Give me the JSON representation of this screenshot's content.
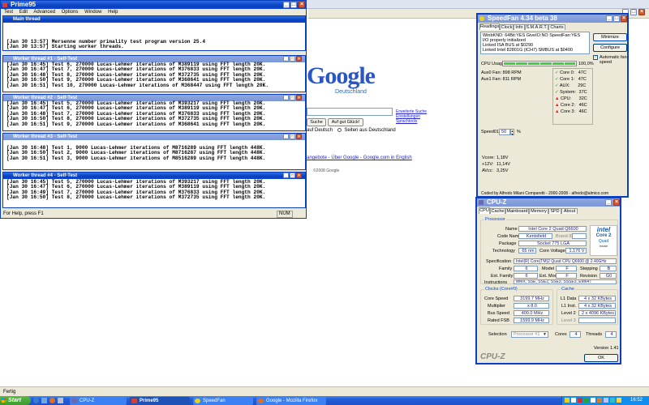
{
  "prime95": {
    "title": "Prime95",
    "menu": [
      "Test",
      "Edit",
      "Advanced",
      "Options",
      "Window",
      "Help"
    ],
    "status_text": "For Help, press F1",
    "status_num": "NUM",
    "main_thread": {
      "title": "Main thread",
      "lines": [
        "[Jan 30 13:57] Mersenne number primality test program version 25.4",
        "[Jan 30 13:57] Starting worker threads."
      ]
    },
    "workers": [
      {
        "title": "Worker thread #1 - Self-Test",
        "lines": [
          "[Jan 30 16:45] Test 6, 270000 Lucas-Lehmer iterations of M389119 using FFT length 20K.",
          "[Jan 30 16:47] Test 7, 270000 Lucas-Lehmer iterations of M376833 using FFT length 20K.",
          "[Jan 30 16:48] Test 8, 270000 Lucas-Lehmer iterations of M372735 using FFT length 20K.",
          "[Jan 30 16:50] Test 9, 270000 Lucas-Lehmer iterations of M368641 using FFT length 20K.",
          "[Jan 30 16:51] Test 10, 270000 Lucas-Lehmer iterations of M368447 using FFT length 20K."
        ]
      },
      {
        "title": "Worker thread #2 - Self-Test",
        "lines": [
          "[Jan 30 16:45] Test 5, 270000 Lucas-Lehmer iterations of M393217 using FFT length 20K.",
          "[Jan 30 16:47] Test 6, 270000 Lucas-Lehmer iterations of M389119 using FFT length 20K.",
          "[Jan 30 16:48] Test 7, 270000 Lucas-Lehmer iterations of M376833 using FFT length 20K.",
          "[Jan 30 16:50] Test 8, 270000 Lucas-Lehmer iterations of M372735 using FFT length 20K.",
          "[Jan 30 16:51] Test 9, 270000 Lucas-Lehmer iterations of M368641 using FFT length 20K."
        ]
      },
      {
        "title": "Worker thread #3 - Self-Test",
        "lines": [
          "[Jan 30 16:48] Test 1, 9000 Lucas-Lehmer iterations of M8716289 using FFT length 448K.",
          "[Jan 30 16:50] Test 2, 9000 Lucas-Lehmer iterations of M8716287 using FFT length 448K.",
          "[Jan 30 16:51] Test 3, 9000 Lucas-Lehmer iterations of M8516289 using FFT length 448K."
        ]
      },
      {
        "title": "Worker thread #4 - Self-Test",
        "lines": [
          "[Jan 30 16:45] Test 5, 270000 Lucas-Lehmer iterations of M393217 using FFT length 20K.",
          "[Jan 30 16:47] Test 6, 270000 Lucas-Lehmer iterations of M389119 using FFT length 20K.",
          "[Jan 30 16:49] Test 7, 270000 Lucas-Lehmer iterations of M376833 using FFT length 20K.",
          "[Jan 30 16:50] Test 8, 270000 Lucas-Lehmer iterations of M372735 using FFT length 20K."
        ]
      }
    ]
  },
  "firefox": {
    "logo_text": "Google",
    "logo_sub": "Deutschland",
    "search_btn_partial": "Suche",
    "lucky_btn": "Auf gut Glück!",
    "radio_label_1": "auf Deutsch",
    "radio_label_2": "Seiten aus Deutschland",
    "side_links": [
      "Erweiterte Suche",
      "Einstellungen",
      "Sprachtools"
    ],
    "footer_links": "angebote - Über Google - Google.com in English",
    "copyright": "©2008 Google",
    "status": "Fertig"
  },
  "speedfan": {
    "title": "SpeedFan 4.34 beta 38",
    "tabs": [
      "Readings",
      "Clock",
      "Info",
      "S.M.A.R.T.",
      "Charts"
    ],
    "log_lines": [
      "WinbKND: 64Bit:YES  GiveIO:NO  SpeedFan:YES",
      "I/O properly initialized",
      "Linked ISA BUS at $0290",
      "Linked Intel 82801G (ICH7) SMBUS at $0400"
    ],
    "minimize_btn": "Minimize",
    "configure_btn": "Configure",
    "auto_fan_label": "Automatic fan speed",
    "cpu_usage_label": "CPU Usage",
    "cpu_usage_value": "100,0%",
    "cpu_usage_level": 1.0,
    "fans": [
      "Aux0 Fan: 898 RPM",
      "Aux1 Fan: 811 RPM"
    ],
    "temps": [
      {
        "name": "Core 0:",
        "value": "47C",
        "icon": "check-icon"
      },
      {
        "name": "Core 1:",
        "value": "47C",
        "icon": "check-icon"
      },
      {
        "name": "AUX:",
        "value": "29C",
        "icon": "check-icon"
      },
      {
        "name": "System:",
        "value": "37C",
        "icon": "check-icon"
      },
      {
        "name": "CPU:",
        "value": "32C",
        "icon": "flame-icon"
      },
      {
        "name": "Core 2:",
        "value": "46C",
        "icon": "flame-icon"
      },
      {
        "name": "Core 3:",
        "value": "46C",
        "icon": "flame-icon"
      }
    ],
    "speed_label": "Speed01:",
    "speed_value": "50",
    "speed_unit": "%",
    "voltages": [
      {
        "name": "Vcore:",
        "value": "1,18V"
      },
      {
        "name": "+12V:",
        "value": "11,14V"
      },
      {
        "name": "AVcc:",
        "value": "3,25V"
      }
    ],
    "footer": "Coded by Alfredo Milani Comparetti - 2000-2008 - alfredo@almico.com"
  },
  "cpuz": {
    "title": "CPU-Z",
    "tabs": [
      "CPU",
      "Cache",
      "Mainboard",
      "Memory",
      "SPD",
      "About"
    ],
    "processor_group": "Processor",
    "name_label": "Name",
    "name_value": "Intel Core 2 Quad Q6600",
    "codename_label": "Code Name",
    "codename_value": "Kentsfield",
    "brand_id_label": "Brand ID",
    "package_label": "Package",
    "package_value": "Socket 775 LGA",
    "technology_label": "Technology",
    "technology_value": "65 nm",
    "core_voltage_label": "Core Voltage",
    "core_voltage_value": "1.176 V",
    "spec_label": "Specification",
    "spec_value": "Intel(R) Core(TM)2 Quad CPU     Q6600  @ 2.40GHz",
    "family_label": "Family",
    "family_value": "6",
    "model_label": "Model",
    "model_value": "F",
    "stepping_label": "Stepping",
    "stepping_value": "B",
    "ext_family_label": "Ext. Family",
    "ext_family_value": "6",
    "ext_model_label": "Ext. Model",
    "ext_model_value": "F",
    "revision_label": "Revision",
    "revision_value": "G0",
    "instructions_label": "Instructions",
    "instructions_value": "MMX, SSE, SSE2, SSE3, SSSE3, EM64T",
    "clocks_group": "Clocks (Core#0)",
    "core_speed_label": "Core Speed",
    "core_speed_value": "3199.7 MHz",
    "multiplier_label": "Multiplier",
    "multiplier_value": "x 8.0",
    "bus_speed_label": "Bus Speed",
    "bus_speed_value": "400.0 MHz",
    "rated_fsb_label": "Rated FSB",
    "rated_fsb_value": "1599.9 MHz",
    "cache_group": "Cache",
    "l1d_label": "L1 Data",
    "l1d_value": "4 x 32 KBytes",
    "l1i_label": "L1 Inst.",
    "l1i_value": "4 x 32 KBytes",
    "l2_label": "Level 2",
    "l2_value": "2 x 4096 KBytes",
    "l3_label": "Level 3",
    "selection_label": "Selection",
    "selection_value": "Processor #1",
    "cores_label": "Cores",
    "cores_value": "4",
    "threads_label": "Threads",
    "threads_value": "4",
    "version": "Version 1.41",
    "ok_btn": "OK",
    "logo_brand": "CPU-Z",
    "intel_logo_text": "intel",
    "intel_logo_line2": "Core 2",
    "intel_logo_line3": "Quad",
    "intel_logo_line4": "inside"
  },
  "taskbar": {
    "start_label": "Start",
    "buttons": [
      "CPU-Z",
      "Prime95",
      "SpeedFan",
      "Google - Mozilla Firefox"
    ],
    "clock": "16:52"
  },
  "colors": {
    "xp_blue": "#0a3fc0",
    "taskbar_blue": "#245edb",
    "start_green": "#3c9a2e",
    "tray_blue": "#0f8ef0"
  }
}
